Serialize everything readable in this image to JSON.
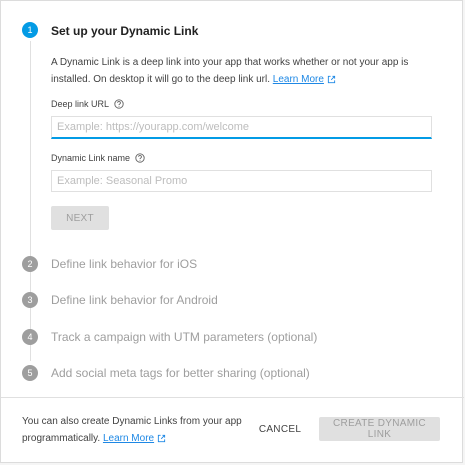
{
  "steps": [
    {
      "number": "1",
      "title": "Set up your Dynamic Link",
      "active": true
    },
    {
      "number": "2",
      "title": "Define link behavior for iOS",
      "active": false
    },
    {
      "number": "3",
      "title": "Define link behavior for Android",
      "active": false
    },
    {
      "number": "4",
      "title": "Track a campaign with UTM parameters (optional)",
      "active": false
    },
    {
      "number": "5",
      "title": "Add social meta tags for better sharing (optional)",
      "active": false
    }
  ],
  "step1": {
    "description": "A Dynamic Link is a deep link into your app that works whether or not your app is installed. On desktop it will go to the deep link url.",
    "learn_more": "Learn More",
    "deep_link": {
      "label": "Deep link URL",
      "placeholder": "Example: https://yourapp.com/welcome",
      "value": ""
    },
    "link_name": {
      "label": "Dynamic Link name",
      "placeholder": "Example: Seasonal Promo",
      "value": ""
    },
    "next_label": "NEXT"
  },
  "footer": {
    "text": "You can also create Dynamic Links from your app programmatically.",
    "learn_more": "Learn More",
    "cancel_label": "CANCEL",
    "create_label": "CREATE DYNAMIC LINK"
  },
  "colors": {
    "accent": "#039be5",
    "link": "#1e88e5",
    "disabled_bg": "#e0e0e0",
    "inactive_step": "#9e9e9e"
  },
  "icons": [
    "open-in-new-icon",
    "help-circle-icon"
  ]
}
